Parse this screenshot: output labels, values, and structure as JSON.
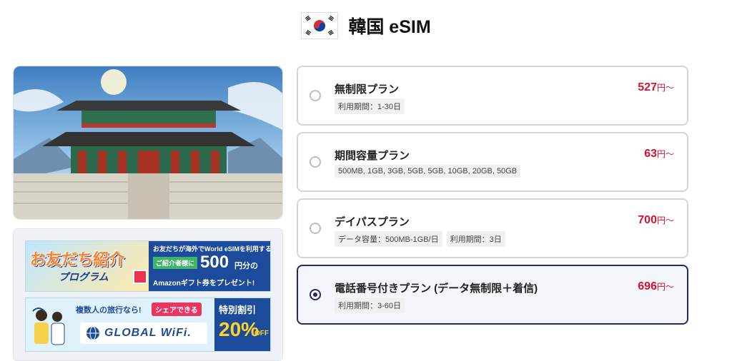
{
  "header": {
    "title": "韓国 eSIM",
    "flag_icon": "south-korea-flag-icon"
  },
  "promo": {
    "referral": {
      "title": "お友だち紹介",
      "subtitle": "プログラム",
      "line1": "お友だちが海外でWorld eSIMを利用すると",
      "badge": "ご紹介者様に",
      "amount": "500",
      "unit": "円分の",
      "line3": "Amazonギフト券をプレゼント!"
    },
    "globalwifi": {
      "line1": "複数人の旅行なら!",
      "badge": "シェアできる",
      "logo": "GLOBAL WiFi.",
      "discount_label": "特別割引",
      "discount": "20%",
      "off": "OFF"
    }
  },
  "plans": [
    {
      "name": "無制限プラン",
      "tags": [
        "利用期間：1-30日"
      ],
      "price": "527",
      "price_unit": "円〜",
      "selected": false
    },
    {
      "name": "期間容量プラン",
      "tags": [
        "500MB, 1GB, 3GB, 5GB, 5GB, 10GB, 20GB, 50GB"
      ],
      "price": "63",
      "price_unit": "円〜",
      "selected": false
    },
    {
      "name": "デイパスプラン",
      "tags": [
        "データ容量：500MB-1GB/日",
        "利用期間：3日"
      ],
      "price": "700",
      "price_unit": "円〜",
      "selected": false
    },
    {
      "name": "電話番号付きプラン (データ無制限＋着信)",
      "tags": [
        "利用期間：3-60日"
      ],
      "price": "696",
      "price_unit": "円〜",
      "selected": true
    }
  ],
  "colors": {
    "accent": "#1c2a6e",
    "price": "#d8102a",
    "border": "#d5d5d5"
  }
}
